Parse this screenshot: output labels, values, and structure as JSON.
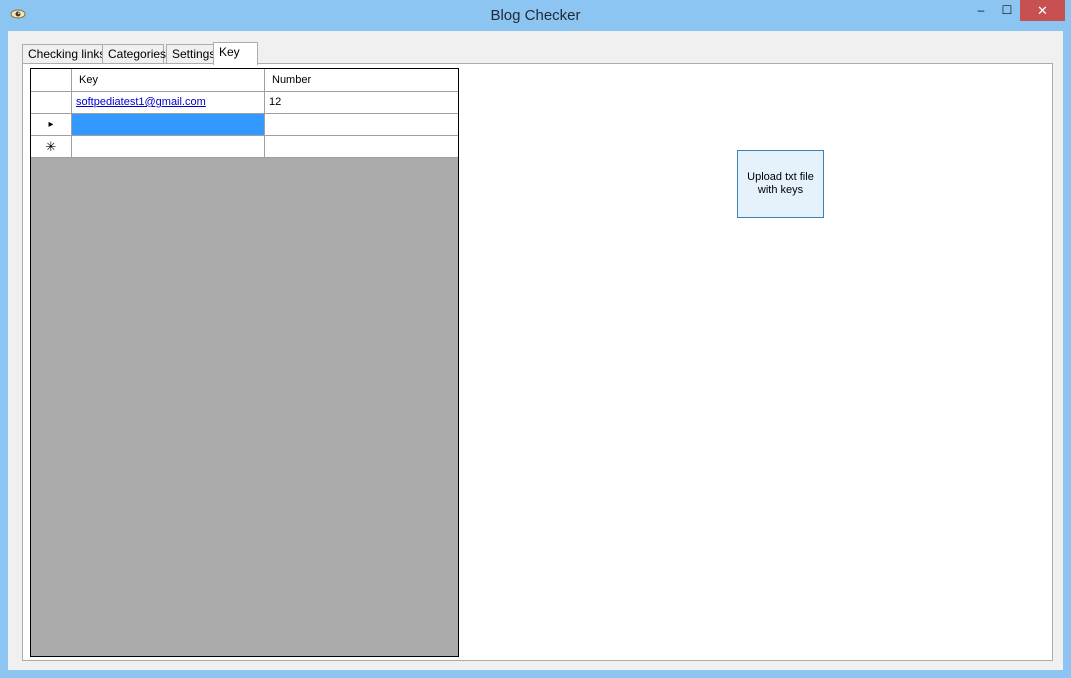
{
  "window": {
    "title": "Blog Checker",
    "icon": "eye-icon",
    "controls": {
      "minimize": "–",
      "maximize": "☐",
      "close": "✕"
    }
  },
  "tabs": [
    {
      "label": "Checking links",
      "active": false
    },
    {
      "label": "Categories",
      "active": false
    },
    {
      "label": "Settings",
      "active": false
    },
    {
      "label": "Key",
      "active": true
    }
  ],
  "grid": {
    "columns": [
      "Key",
      "Number"
    ],
    "rows": [
      {
        "marker": "",
        "key": "softpediatest1@gmail.com",
        "number": "12"
      },
      {
        "marker": "▸",
        "key": "",
        "number": "",
        "selected": true
      },
      {
        "marker": "✳",
        "key": "",
        "number": ""
      }
    ]
  },
  "upload_button": {
    "label": "Upload txt file with keys"
  },
  "colors": {
    "accent": "#3399ff",
    "frame": "#8cc4f2",
    "close_button": "#c75050",
    "grid_background": "#ababab"
  }
}
